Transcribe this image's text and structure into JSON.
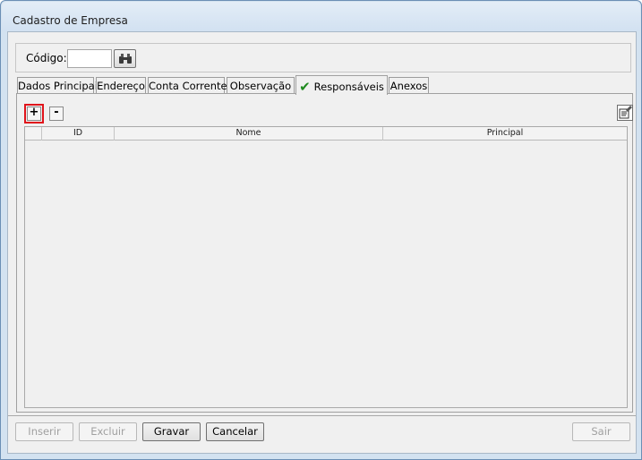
{
  "window": {
    "title": "Cadastro de Empresa"
  },
  "code": {
    "label": "Código:",
    "value": ""
  },
  "tabs": [
    {
      "label": "Dados Principais"
    },
    {
      "label": "Endereço"
    },
    {
      "label": "Conta Corrente"
    },
    {
      "label": "Observação"
    },
    {
      "label": "Responsáveis",
      "active": true,
      "icon": "check-icon"
    },
    {
      "label": "Anexos"
    }
  ],
  "toolbar": {
    "add_label": "+",
    "remove_label": "-",
    "edit_icon": "edit-icon"
  },
  "grid": {
    "columns": [
      "",
      "ID",
      "Nome",
      "Principal"
    ],
    "rows": []
  },
  "buttons": {
    "inserir": "Inserir",
    "excluir": "Excluir",
    "gravar": "Gravar",
    "cancelar": "Cancelar",
    "sair": "Sair"
  },
  "colors": {
    "accent_check": "#1e8a1e",
    "highlight": "#e0141b"
  }
}
